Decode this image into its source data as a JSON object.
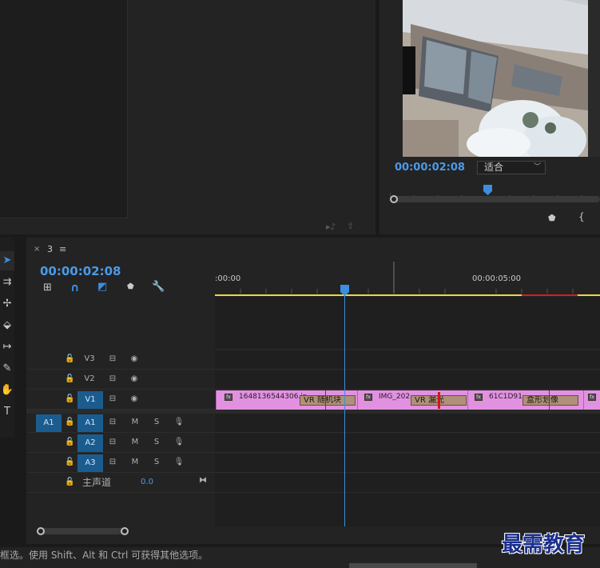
{
  "program_monitor": {
    "timecode": "00:00:02:08",
    "fit_label": "适合"
  },
  "sequence": {
    "tab_label": "3",
    "timecode": "00:00:02:08",
    "ruler": {
      "start_label": ":00:00",
      "mid_label": "00:00:05:00"
    },
    "progress": {
      "playhead_fraction": 0.33
    }
  },
  "tracks": {
    "v3": "V3",
    "v2": "V2",
    "v1": "V1",
    "a1_source": "A1",
    "a1": "A1",
    "a2": "A2",
    "a3": "A3",
    "m": "M",
    "s": "S",
    "master_label": "主声道",
    "master_value": "0.0"
  },
  "clips": [
    {
      "name": "1648136544306.jp"
    },
    {
      "name": "IMG_202"
    },
    {
      "name": "61C1D91"
    }
  ],
  "transitions": [
    {
      "name": "VR 随机块"
    },
    {
      "name": "VR 漏光"
    },
    {
      "name": "盒形划像"
    }
  ],
  "status_bar": {
    "text": "框选。使用 Shift、Alt 和 Ctrl 可获得其他选项。"
  },
  "watermark": "最需教育",
  "colors": {
    "accent": "#4a9be8",
    "clip": "#e191e0",
    "track_active": "#1b5c8e"
  }
}
